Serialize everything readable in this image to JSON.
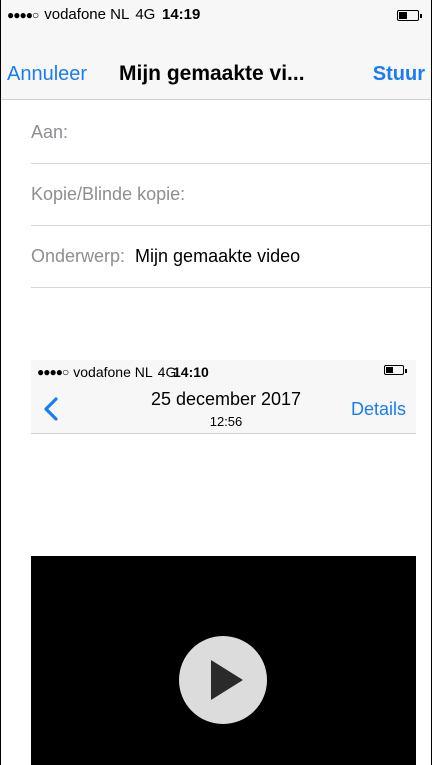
{
  "status_bar": {
    "signal": "●●●●○",
    "carrier": "vodafone NL",
    "network": "4G",
    "time": "14:19",
    "battery_level": 0.35
  },
  "nav": {
    "cancel_label": "Annuleer",
    "title": "Mijn gemaakte vi...",
    "send_label": "Stuur"
  },
  "fields": {
    "to_label": "Aan:",
    "cc_label": "Kopie/Blinde kopie:",
    "subject_label": "Onderwerp:",
    "subject_value": "Mijn gemaakte video"
  },
  "attachment": {
    "status_bar": {
      "signal": "●●●●○",
      "carrier": "vodafone NL",
      "network": "4G",
      "time": "14:10"
    },
    "back_icon": "chevron-left-icon",
    "date": "25 december 2017",
    "time": "12:56",
    "details_label": "Details",
    "play_icon": "play-icon"
  },
  "colors": {
    "accent": "#1a7cf5",
    "label_gray": "#8e8e93",
    "bar_bg": "#f7f7f7"
  }
}
